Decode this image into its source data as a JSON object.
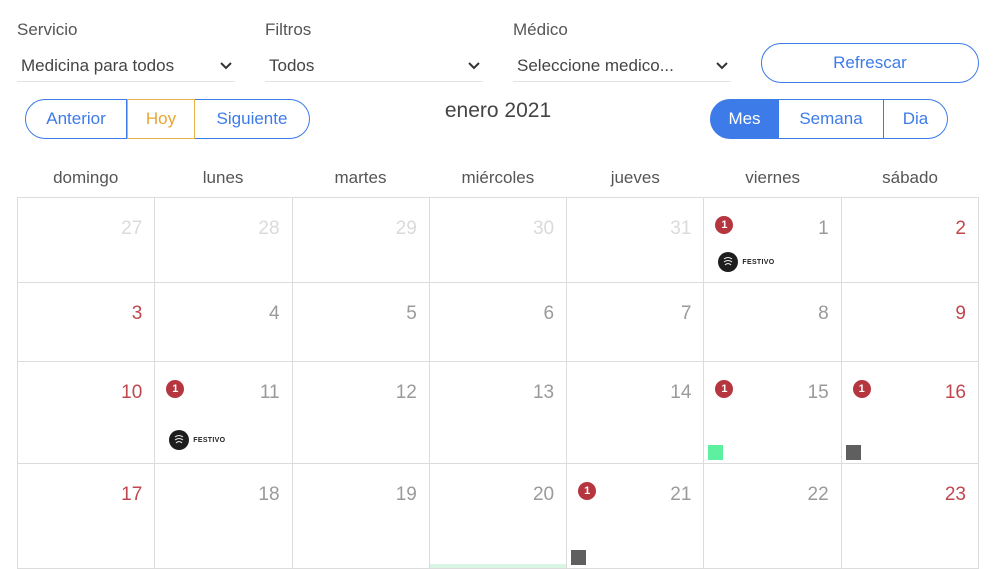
{
  "filters": [
    {
      "label": "Servicio",
      "value": "Medicina para todos"
    },
    {
      "label": "Filtros",
      "value": "Todos"
    },
    {
      "label": "Médico",
      "value": "Seleccione medico..."
    }
  ],
  "refresh_label": "Refrescar",
  "nav": {
    "prev": "Anterior",
    "today": "Hoy",
    "next": "Siguiente"
  },
  "title": "enero 2021",
  "views": {
    "month": "Mes",
    "week": "Semana",
    "day": "Dia"
  },
  "weekdays": [
    "domingo",
    "lunes",
    "martes",
    "miércoles",
    "jueves",
    "viernes",
    "sábado"
  ],
  "colors": {
    "accent": "#3d7be8",
    "today": "#e8a630",
    "weekend": "#c0474e",
    "badge": "#b5363f",
    "event_green": "#5cf0a0",
    "event_gray": "#5f5f5f"
  },
  "weeks": [
    [
      {
        "day": "27",
        "other": true
      },
      {
        "day": "28",
        "other": true
      },
      {
        "day": "29",
        "other": true
      },
      {
        "day": "30",
        "other": true
      },
      {
        "day": "31",
        "other": true
      },
      {
        "day": "1",
        "badge": "1",
        "festivo": "FESTIVO"
      },
      {
        "day": "2",
        "weekend": true
      }
    ],
    [
      {
        "day": "3",
        "weekend": true
      },
      {
        "day": "4"
      },
      {
        "day": "5"
      },
      {
        "day": "6"
      },
      {
        "day": "7"
      },
      {
        "day": "8"
      },
      {
        "day": "9",
        "weekend": true
      }
    ],
    [
      {
        "day": "10",
        "weekend": true
      },
      {
        "day": "11",
        "badge": "1",
        "festivo": "FESTIVO"
      },
      {
        "day": "12"
      },
      {
        "day": "13"
      },
      {
        "day": "14"
      },
      {
        "day": "15",
        "badge": "1",
        "event": "green"
      },
      {
        "day": "16",
        "weekend": true,
        "badge": "1",
        "event": "gray"
      }
    ],
    [
      {
        "day": "17",
        "weekend": true
      },
      {
        "day": "18"
      },
      {
        "day": "19"
      },
      {
        "day": "20",
        "highlight": true
      },
      {
        "day": "21",
        "badge": "1",
        "event": "gray"
      },
      {
        "day": "22"
      },
      {
        "day": "23",
        "weekend": true
      }
    ]
  ]
}
